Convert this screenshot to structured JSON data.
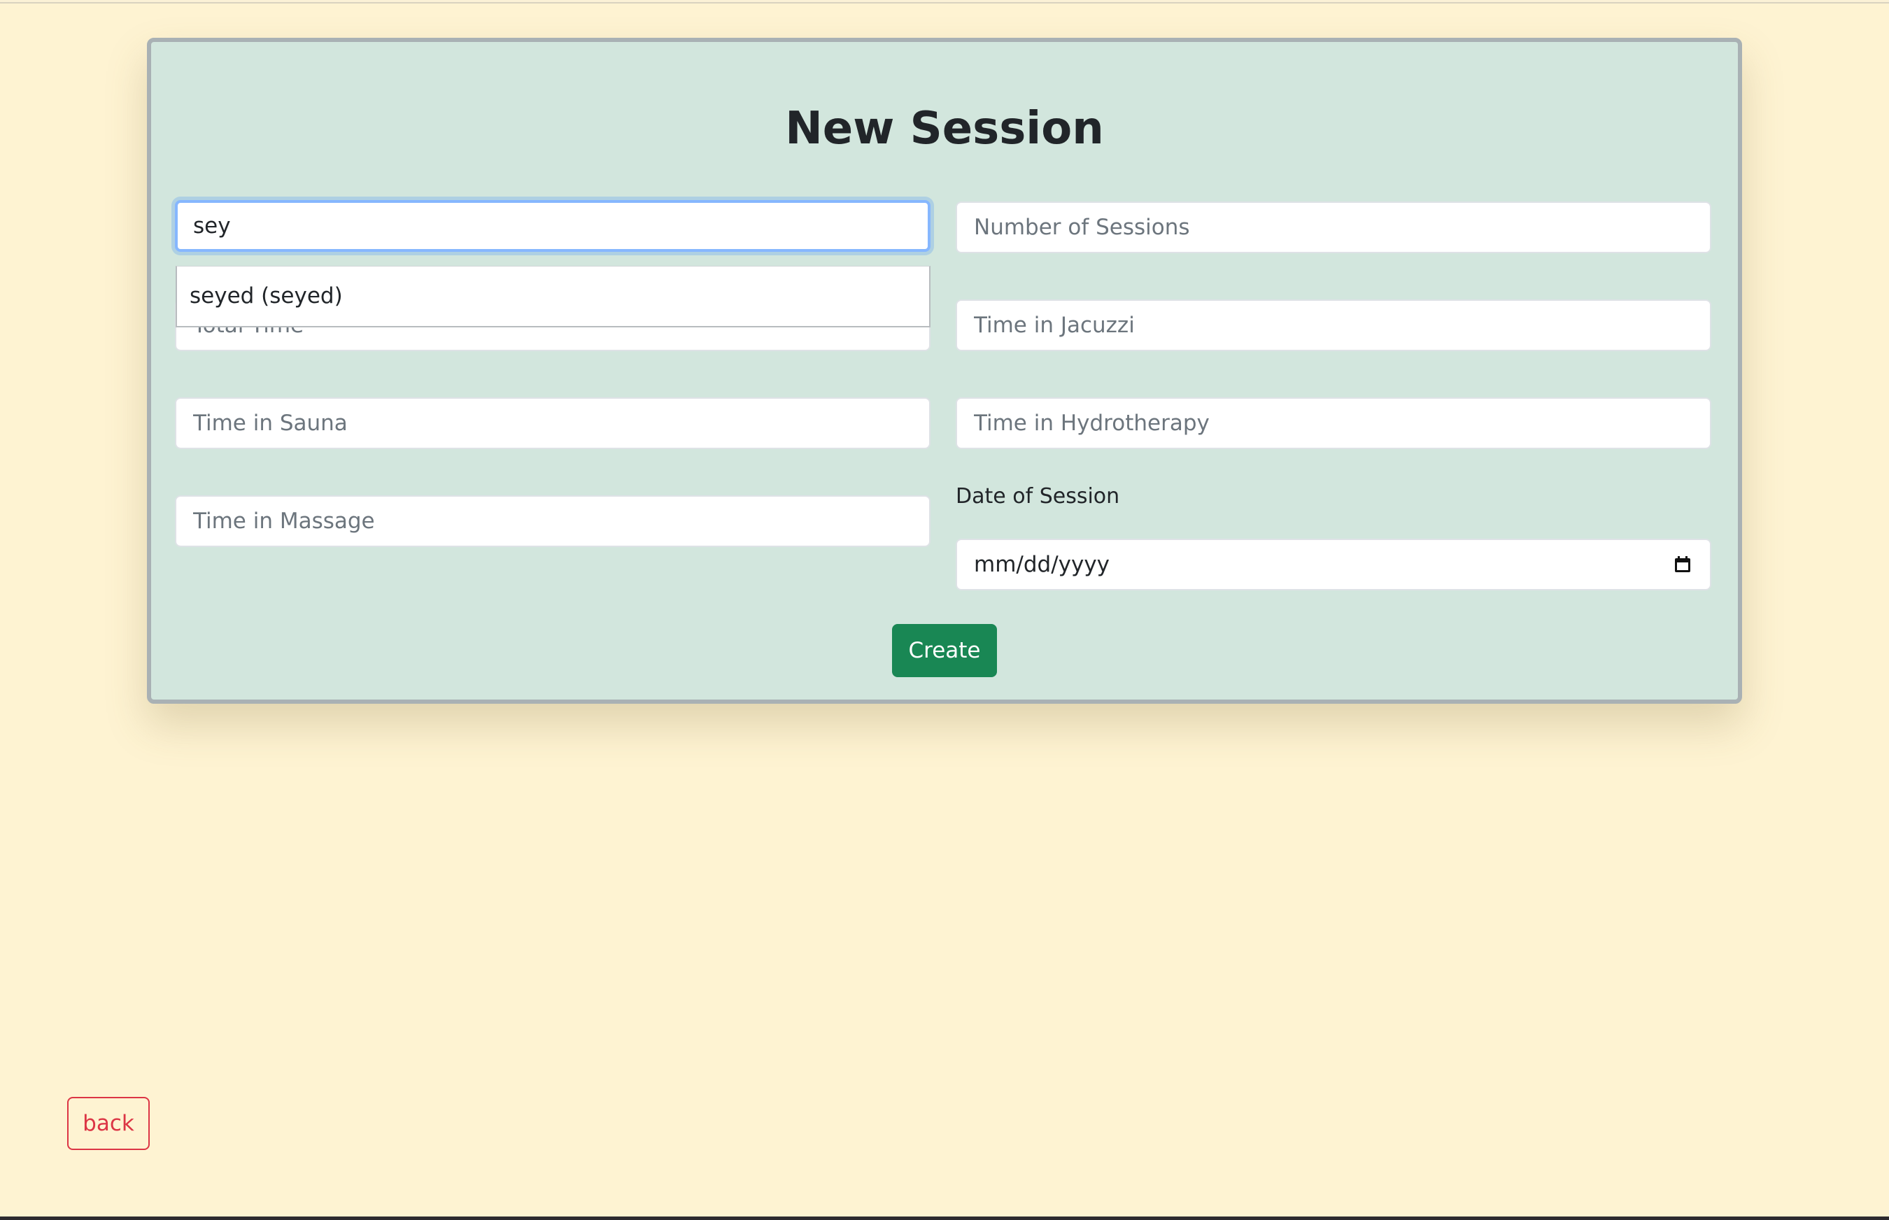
{
  "page": {
    "background_color": "#fef3d2"
  },
  "form": {
    "title": "New Session",
    "user_search": {
      "value": "sey",
      "placeholder": "Total Time"
    },
    "autocomplete_option": "seyed (seyed)",
    "fields": {
      "number_of_sessions": {
        "placeholder": "Number of Sessions"
      },
      "total_time": {
        "placeholder": "Total Time"
      },
      "time_in_jacuzzi": {
        "placeholder": "Time in Jacuzzi"
      },
      "time_in_sauna": {
        "placeholder": "Time in Sauna"
      },
      "time_in_hydrotherapy": {
        "placeholder": "Time in Hydrotherapy"
      },
      "time_in_massage": {
        "placeholder": "Time in Massage"
      }
    },
    "date": {
      "label": "Date of Session",
      "value_placeholder": "mm/dd/yyyy",
      "icon": "calendar-icon"
    },
    "create_label": "Create",
    "colors": {
      "card_background": "#d2e6dd",
      "create_button": "#198754",
      "back_button": "#dc3545"
    }
  },
  "nav": {
    "back_label": "back"
  }
}
